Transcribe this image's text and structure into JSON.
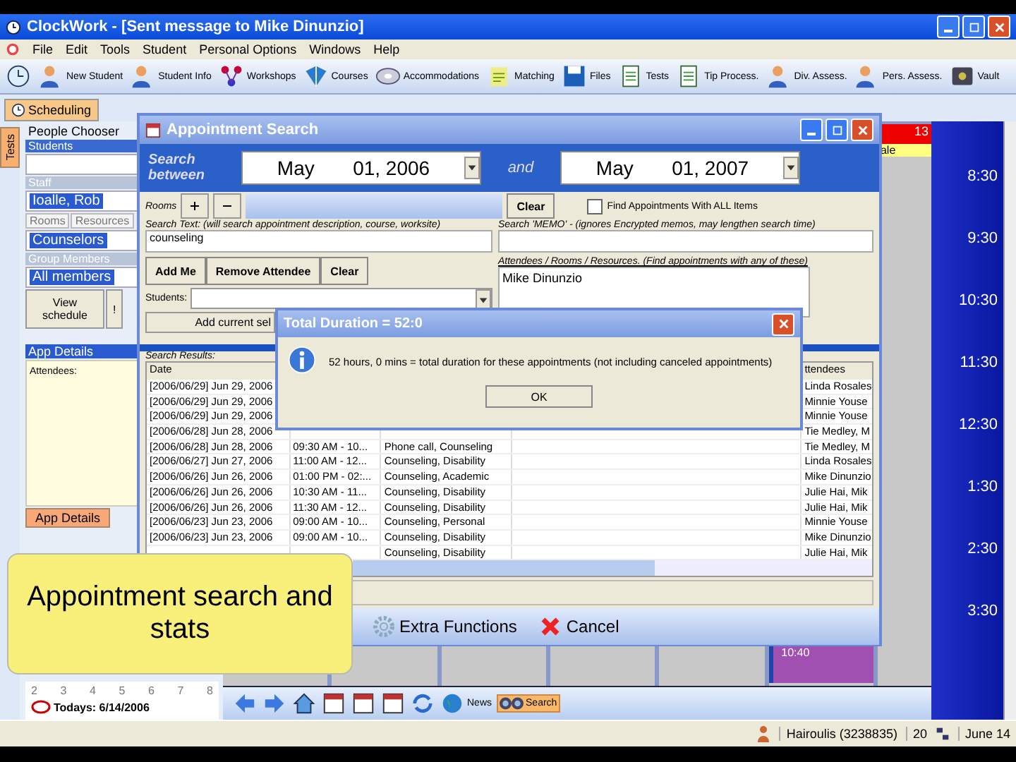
{
  "window": {
    "title": "ClockWork - [Sent message to Mike Dinunzio]"
  },
  "menu": [
    "File",
    "Edit",
    "Tools",
    "Student",
    "Personal Options",
    "Windows",
    "Help"
  ],
  "toolbar": [
    "New Student",
    "Student Info",
    "Workshops",
    "Courses",
    "Accommodations",
    "Matching",
    "Files",
    "Tests",
    "Tip Process.",
    "Div. Assess.",
    "Pers. Assess.",
    "Vault"
  ],
  "tabs": [
    {
      "label": "Scheduling",
      "selected": true
    }
  ],
  "side_tab": {
    "label": "Tests"
  },
  "people_chooser": {
    "title": "People Chooser",
    "students_header": "Students",
    "staff_header": "Staff",
    "staff_selected": "Ioalle, Rob",
    "tabs": [
      {
        "label": "Rooms",
        "selected": false
      },
      {
        "label": "Resources",
        "selected": false
      }
    ],
    "group": "Counselors",
    "members_header": "Group Members",
    "members": "All members",
    "buttons": [
      "View schedule",
      "!"
    ]
  },
  "app_details": {
    "title": "App Details",
    "attendees_label": "Attendees:",
    "tab": {
      "label": "App Details",
      "selected": true
    }
  },
  "mini_calendar": {
    "week": [
      "2",
      "3",
      "4",
      "5",
      "6",
      "7",
      "8"
    ],
    "today": "Todays: 6/14/2006"
  },
  "calendar": {
    "day_number": "13",
    "banner": "ale",
    "appointment": "10:40",
    "time_labels": [
      "8:30",
      "9:30",
      "10:30",
      "11:30",
      "12:30",
      "1:30",
      "2:30",
      "3:30"
    ]
  },
  "nav": [
    {
      "label": "News",
      "selected": false
    },
    {
      "label": "Search",
      "selected": true
    }
  ],
  "status_bar": {
    "user": "Hairoulis (3238835)",
    "count": "20",
    "date": "June 14"
  },
  "dialog": {
    "title": "Appointment Search",
    "search_label": "Search between",
    "from": "May       01, 2006",
    "and": "and",
    "to": "May       01, 2007",
    "rooms_label": "Rooms",
    "clear": "Clear",
    "all_items": {
      "label": "Find Appointments With ALL Items",
      "checked": false
    },
    "text_label": "Search Text: (will search appointment description, course, worksite)",
    "text_value": "counseling",
    "memo_label": "Search 'MEMO' - (ignores Encrypted memos, may lengthen search time)",
    "buttons": [
      "Add Me",
      "Remove Attendee",
      "Clear"
    ],
    "attendees_label": "Attendees / Rooms / Resources. (Find appointments with any of these)",
    "attendees": [
      "Mike Dinunzio"
    ],
    "students_label": "Students:",
    "add_current": "Add current sel",
    "results_label": "Search Results:",
    "date_header": "Date",
    "attendees_header": "ttendees",
    "rows": [
      {
        "date": "[2006/06/29] Jun 29, 2006",
        "attendees": "Linda Rosales"
      },
      {
        "date": "[2006/06/29] Jun 29, 2006",
        "attendees": "Minnie Youse"
      },
      {
        "date": "[2006/06/29] Jun 29, 2006",
        "attendees": "Minnie Youse"
      },
      {
        "date": "[2006/06/28] Jun 28, 2006",
        "attendees": "Tie Medley, M"
      },
      {
        "date": "[2006/06/28] Jun 28, 2006",
        "time": "09:30 AM - 10...",
        "description": "Phone call, Counseling",
        "attendees": "Tie Medley, M"
      },
      {
        "date": "[2006/06/27] Jun 27, 2006",
        "time": "11:00 AM - 12...",
        "description": "Counseling, Disability",
        "attendees": "Linda Rosales"
      },
      {
        "date": "[2006/06/26] Jun 26, 2006",
        "time": "01:00 PM - 02:...",
        "description": "Counseling, Academic",
        "attendees": "Mike Dinunzio"
      },
      {
        "date": "[2006/06/26] Jun 26, 2006",
        "time": "10:30 AM - 11...",
        "description": "Counseling, Disability",
        "attendees": "Julie Hai, Mik"
      },
      {
        "date": "[2006/06/26] Jun 26, 2006",
        "time": "11:30 AM - 12...",
        "description": "Counseling, Disability",
        "attendees": "Julie Hai, Mik"
      },
      {
        "date": "[2006/06/23] Jun 23, 2006",
        "time": "09:00 AM - 10...",
        "description": "Counseling, Personal",
        "attendees": "Minnie Youse"
      },
      {
        "date": "[2006/06/23] Jun 23, 2006",
        "time": "09:00 AM - 10...",
        "description": "Counseling, Disability",
        "attendees": "Mike Dinunzio"
      },
      {
        "description": "Counseling, Disability",
        "attendees": "Julie Hai, Mik"
      }
    ],
    "footer": [
      "Extra Functions",
      "Cancel"
    ]
  },
  "info": {
    "title": "Total Duration = 52:0",
    "message": "52 hours, 0 mins = total duration for these appointments (not including canceled appointments)",
    "ok": "OK"
  },
  "callout": {
    "text": "Appointment search and stats"
  }
}
